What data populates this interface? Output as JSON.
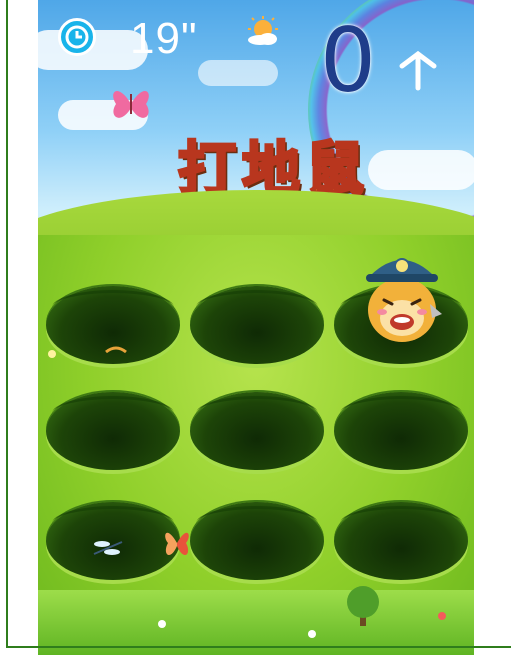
{
  "hud": {
    "timer": "19\"",
    "score": "0"
  },
  "title": {
    "logo_text": "打地鼠"
  },
  "board": {
    "rows": 3,
    "cols": 3,
    "mole_position": {
      "row": 1,
      "col": 3
    }
  },
  "icons": {
    "timer": "clock-icon",
    "weather": "sun-icon",
    "up": "arrow-up-icon"
  },
  "colors": {
    "score": "#1f3d8a",
    "clock": "#19b4ea",
    "grass": "#8fcf2a",
    "hole": "#1d4408"
  }
}
